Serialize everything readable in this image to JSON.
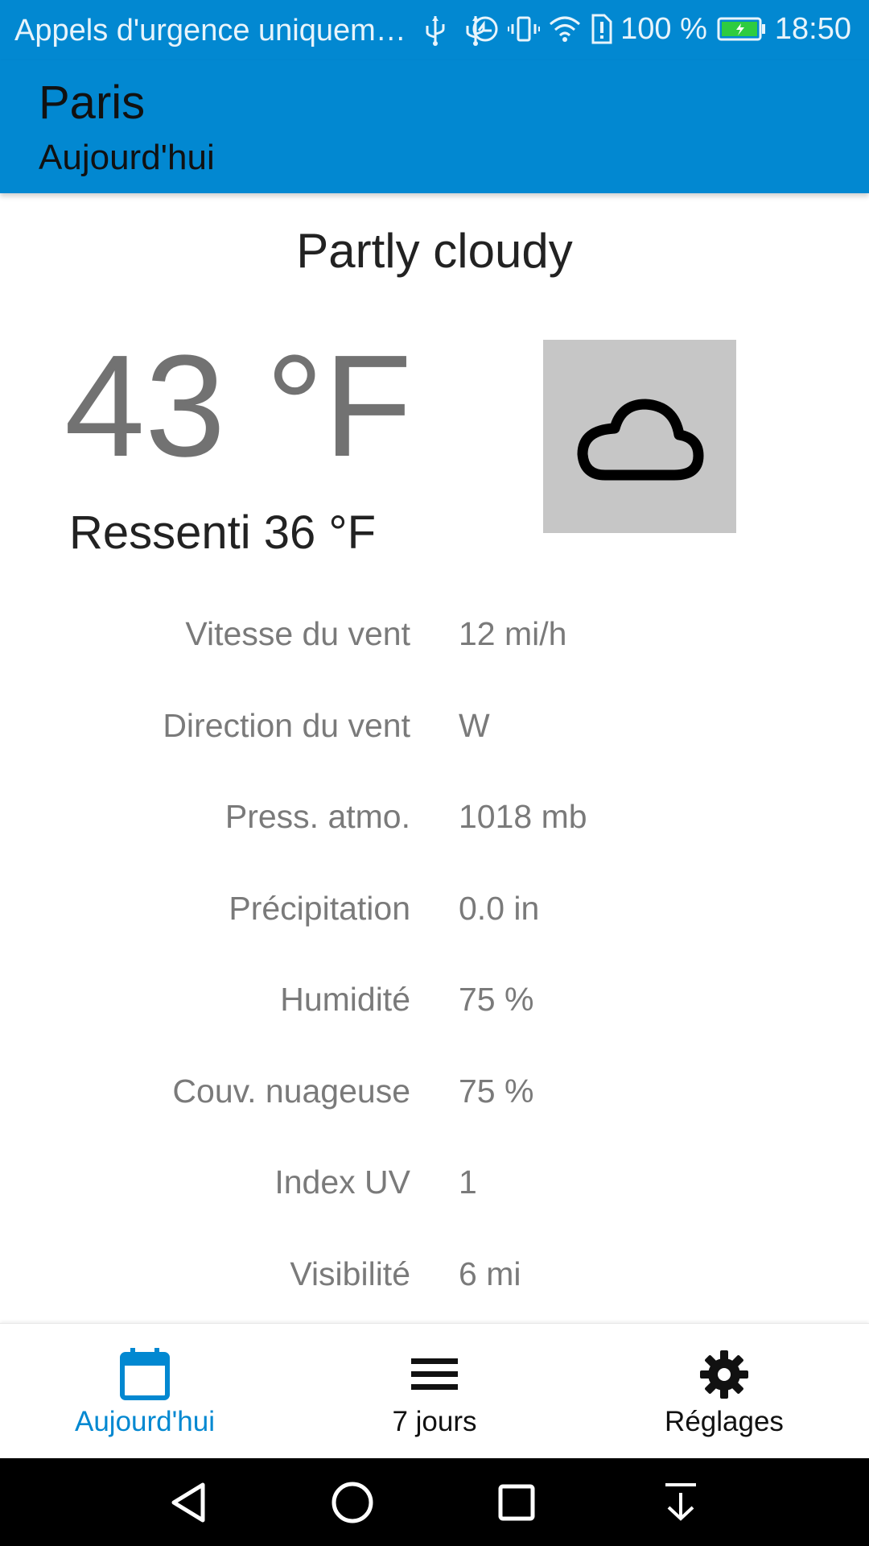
{
  "status_bar": {
    "carrier_text": "Appels d'urgence uniquem…",
    "battery_percent": "100 %",
    "time": "18:50"
  },
  "header": {
    "city": "Paris",
    "subtitle": "Aujourd'hui"
  },
  "weather": {
    "condition": "Partly cloudy",
    "temperature": "43 °F",
    "feels_like": "Ressenti 36 °F",
    "icon": "cloud-icon"
  },
  "details": [
    {
      "label": "Vitesse du vent",
      "value": "12 mi/h"
    },
    {
      "label": "Direction du vent",
      "value": "W"
    },
    {
      "label": "Press. atmo.",
      "value": "1018 mb"
    },
    {
      "label": "Précipitation",
      "value": "0.0 in"
    },
    {
      "label": "Humidité",
      "value": "75 %"
    },
    {
      "label": "Couv. nuageuse",
      "value": "75 %"
    },
    {
      "label": "Index UV",
      "value": "1"
    },
    {
      "label": "Visibilité",
      "value": "6 mi"
    }
  ],
  "bottom_nav": {
    "items": [
      {
        "label": "Aujourd'hui",
        "icon": "calendar-icon",
        "active": true
      },
      {
        "label": "7 jours",
        "icon": "list-icon",
        "active": false
      },
      {
        "label": "Réglages",
        "icon": "gear-icon",
        "active": false
      }
    ]
  },
  "colors": {
    "primary": "#0288d1",
    "active_nav": "#0288d1",
    "icon_box": "#c6c6c6",
    "battery_fill": "#2ecc40"
  }
}
